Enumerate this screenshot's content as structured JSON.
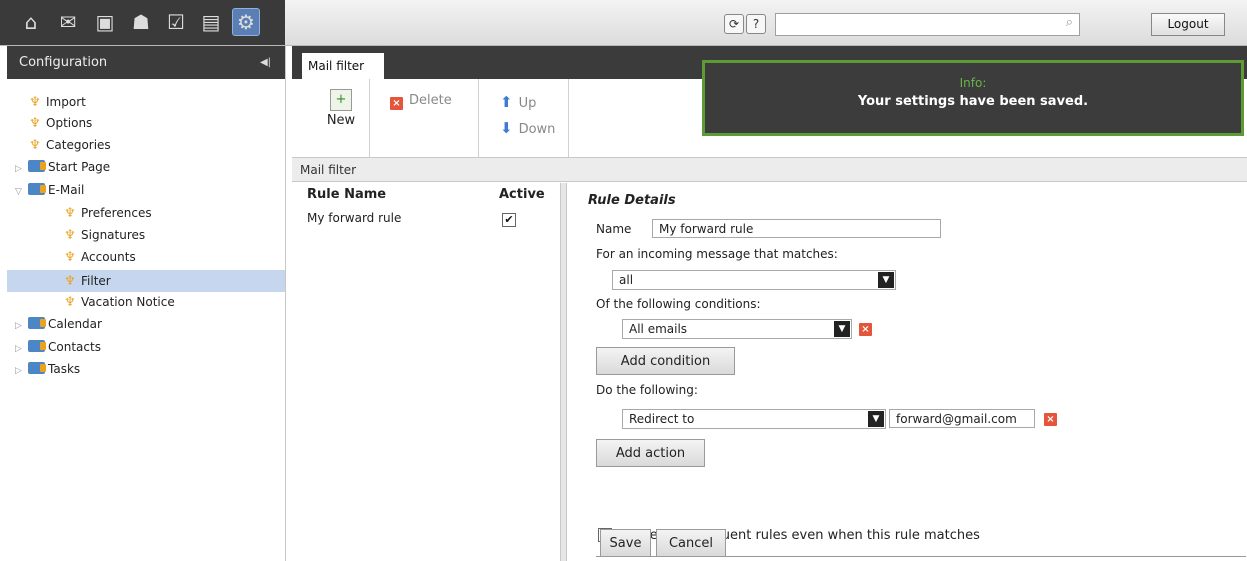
{
  "topbar": {
    "apps": [
      {
        "name": "home-icon",
        "glyph": "⌂"
      },
      {
        "name": "mail-icon",
        "glyph": "✉"
      },
      {
        "name": "calendar-icon",
        "glyph": "▣"
      },
      {
        "name": "contacts-icon",
        "glyph": "☗"
      },
      {
        "name": "tasks-icon",
        "glyph": "☑"
      },
      {
        "name": "briefcase-icon",
        "glyph": "▤"
      },
      {
        "name": "settings-icon",
        "glyph": "⚙"
      }
    ],
    "refresh_glyph": "⟳",
    "help_glyph": "?",
    "search_placeholder": "",
    "search_glyph": "⌕",
    "logout_label": "Logout"
  },
  "sidebar": {
    "title": "Configuration",
    "collapse_glyph": "◀|",
    "items": [
      {
        "label": "Import"
      },
      {
        "label": "Options"
      },
      {
        "label": "Categories"
      },
      {
        "label": "Start Page"
      },
      {
        "label": "E-Mail"
      },
      {
        "label": "Preferences"
      },
      {
        "label": "Signatures"
      },
      {
        "label": "Accounts"
      },
      {
        "label": "Filter"
      },
      {
        "label": "Vacation Notice"
      },
      {
        "label": "Calendar"
      },
      {
        "label": "Contacts"
      },
      {
        "label": "Tasks"
      }
    ]
  },
  "main": {
    "tab_label": "Mail filter",
    "toolbar": {
      "new_label": "New",
      "delete_label": "Delete",
      "up_label": "Up",
      "down_label": "Down"
    },
    "info": {
      "title": "Info:",
      "message": "Your settings have been saved."
    },
    "subheader": "Mail filter",
    "list": {
      "col_rule_name": "Rule Name",
      "col_active": "Active",
      "rows": [
        {
          "name": "My forward rule",
          "active": true
        }
      ]
    },
    "details": {
      "heading": "Rule Details",
      "name_label": "Name",
      "name_value": "My forward rule",
      "match_label": "For an incoming message that matches:",
      "match_value": "all",
      "conditions_label": "Of the following conditions:",
      "condition_value": "All emails",
      "add_condition_label": "Add condition",
      "actions_label": "Do the following:",
      "action_value": "Redirect to",
      "action_target": "forward@gmail.com",
      "add_action_label": "Add action",
      "process_label": "Process subsequent rules even when this rule matches",
      "save_label": "Save",
      "cancel_label": "Cancel"
    }
  }
}
